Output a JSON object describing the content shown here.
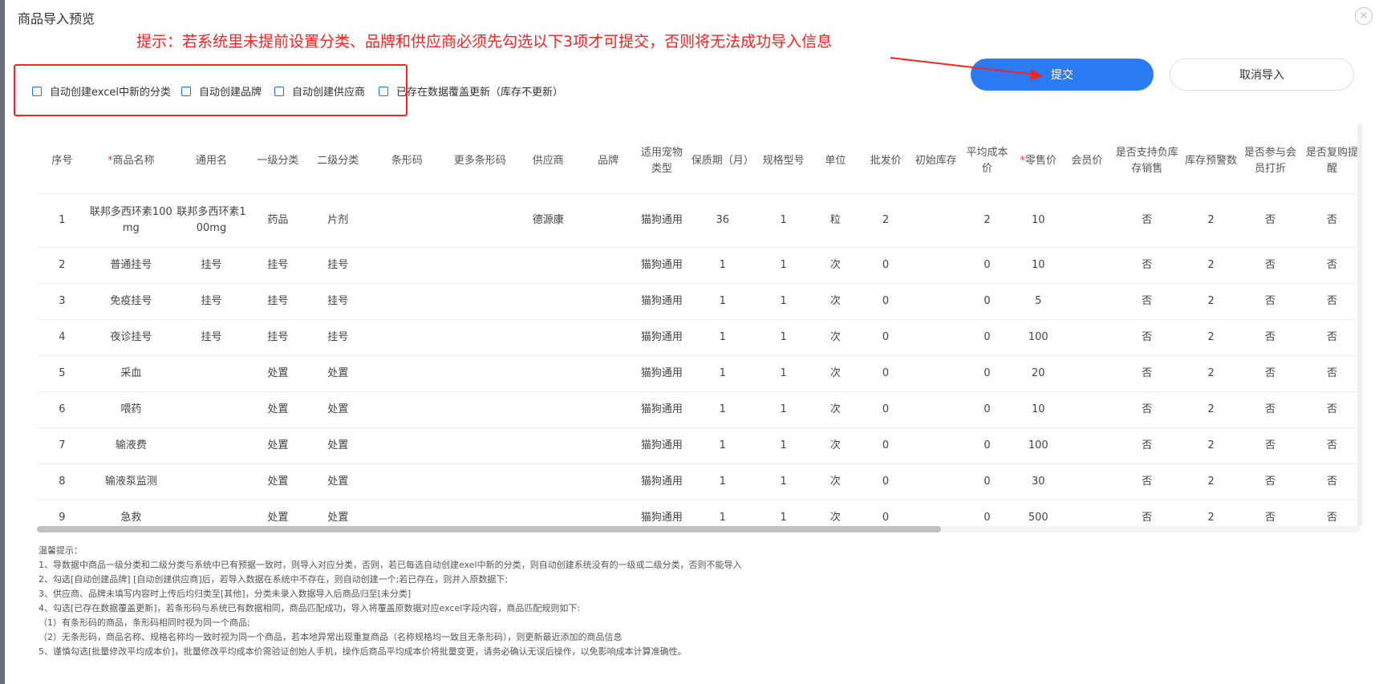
{
  "dialog": {
    "title": "商品导入预览",
    "close_glyph": "✕",
    "tip": "提示：若系统里未提前设置分类、品牌和供应商必须先勾选以下3项才可提交，否则将无法成功导入信息"
  },
  "options": [
    "自动创建excel中新的分类",
    "自动创建品牌",
    "自动创建供应商",
    "已存在数据覆盖更新（库存不更新）"
  ],
  "buttons": {
    "submit": "提交",
    "cancel": "取消导入"
  },
  "colors": {
    "accent": "#2b7bf4",
    "warning": "#ff1f1f",
    "required": "#ff3333"
  },
  "table": {
    "headers": [
      "序号",
      "商品名称",
      "通用名",
      "一级分类",
      "二级分类",
      "条形码",
      "更多条形码",
      "供应商",
      "品牌",
      "适用宠物类型",
      "保质期（月）",
      "规格型号",
      "单位",
      "批发价",
      "初始库存",
      "平均成本价",
      "零售价",
      "会员价",
      "是否支持负库存销售",
      "库存预警数",
      "是否参与会员打折",
      "是否复购提醒"
    ],
    "rows": [
      [
        "1",
        "联邦多西环素100mg",
        "联邦多西环素100mg",
        "药品",
        "片剂",
        "",
        "",
        "德源康",
        "",
        "猫狗通用",
        "36",
        "1",
        "粒",
        "2",
        "",
        "2",
        "10",
        "",
        "否",
        "2",
        "否",
        "否"
      ],
      [
        "2",
        "普通挂号",
        "挂号",
        "挂号",
        "挂号",
        "",
        "",
        "",
        "",
        "猫狗通用",
        "1",
        "1",
        "次",
        "0",
        "",
        "0",
        "10",
        "",
        "否",
        "2",
        "否",
        "否"
      ],
      [
        "3",
        "免疫挂号",
        "挂号",
        "挂号",
        "挂号",
        "",
        "",
        "",
        "",
        "猫狗通用",
        "1",
        "1",
        "次",
        "0",
        "",
        "0",
        "5",
        "",
        "否",
        "2",
        "否",
        "否"
      ],
      [
        "4",
        "夜诊挂号",
        "挂号",
        "挂号",
        "挂号",
        "",
        "",
        "",
        "",
        "猫狗通用",
        "1",
        "1",
        "次",
        "0",
        "",
        "0",
        "100",
        "",
        "否",
        "2",
        "否",
        "否"
      ],
      [
        "5",
        "采血",
        "",
        "处置",
        "处置",
        "",
        "",
        "",
        "",
        "猫狗通用",
        "1",
        "1",
        "次",
        "0",
        "",
        "0",
        "20",
        "",
        "否",
        "2",
        "否",
        "否"
      ],
      [
        "6",
        "喂药",
        "",
        "处置",
        "处置",
        "",
        "",
        "",
        "",
        "猫狗通用",
        "1",
        "1",
        "次",
        "0",
        "",
        "0",
        "10",
        "",
        "否",
        "2",
        "否",
        "否"
      ],
      [
        "7",
        "输液费",
        "",
        "处置",
        "处置",
        "",
        "",
        "",
        "",
        "猫狗通用",
        "1",
        "1",
        "次",
        "0",
        "",
        "0",
        "100",
        "",
        "否",
        "2",
        "否",
        "否"
      ],
      [
        "8",
        "输液泵监测",
        "",
        "处置",
        "处置",
        "",
        "",
        "",
        "",
        "猫狗通用",
        "1",
        "1",
        "次",
        "0",
        "",
        "0",
        "30",
        "",
        "否",
        "2",
        "否",
        "否"
      ],
      [
        "9",
        "急救",
        "",
        "处置",
        "处置",
        "",
        "",
        "",
        "",
        "猫狗通用",
        "1",
        "1",
        "次",
        "0",
        "",
        "0",
        "500",
        "",
        "否",
        "2",
        "否",
        "否"
      ]
    ]
  },
  "notes": [
    "温馨提示：",
    "1、导数据中商品一级分类和二级分类与系统中已有预据一致时，则导入对应分类，否则，若已每选自动创建exel中新的分类，则自动创建系统没有的一级或二级分类，否则不能导入",
    "2、勾选[自动创建品牌] [自动创建供应商]后，若导入数据在系统中不存在，则自动创建一个;若已存在，则并入原数据下;",
    "3、供应商、品牌未填写内容时上传后均归类至[其他]，分类未录入数据导入后商品归至[未分类]",
    "4、勾选[已存在数据覆盖更新]，若条形码与系统已有数据相同，商品匹配成功，导入将覆盖原数据对应excel字段内容，商品匹配规则如下:",
    "（1）有条形码的商品，条形码相同时视为同一个商品;",
    "（2）无条形码，商品名称、规格名称均一致时视为同一个商品，若本地异常出现重复商品（名称规格均一致且无条形码），则更新最近添加的商品信息",
    "5、谨慎勾选[批量修改平均成本价]，批量修改平均成本价需验证创始人手机，操作后商品平均成本价将批量变更，请务必确认无误后操作，以免影响成本计算准确性。"
  ]
}
